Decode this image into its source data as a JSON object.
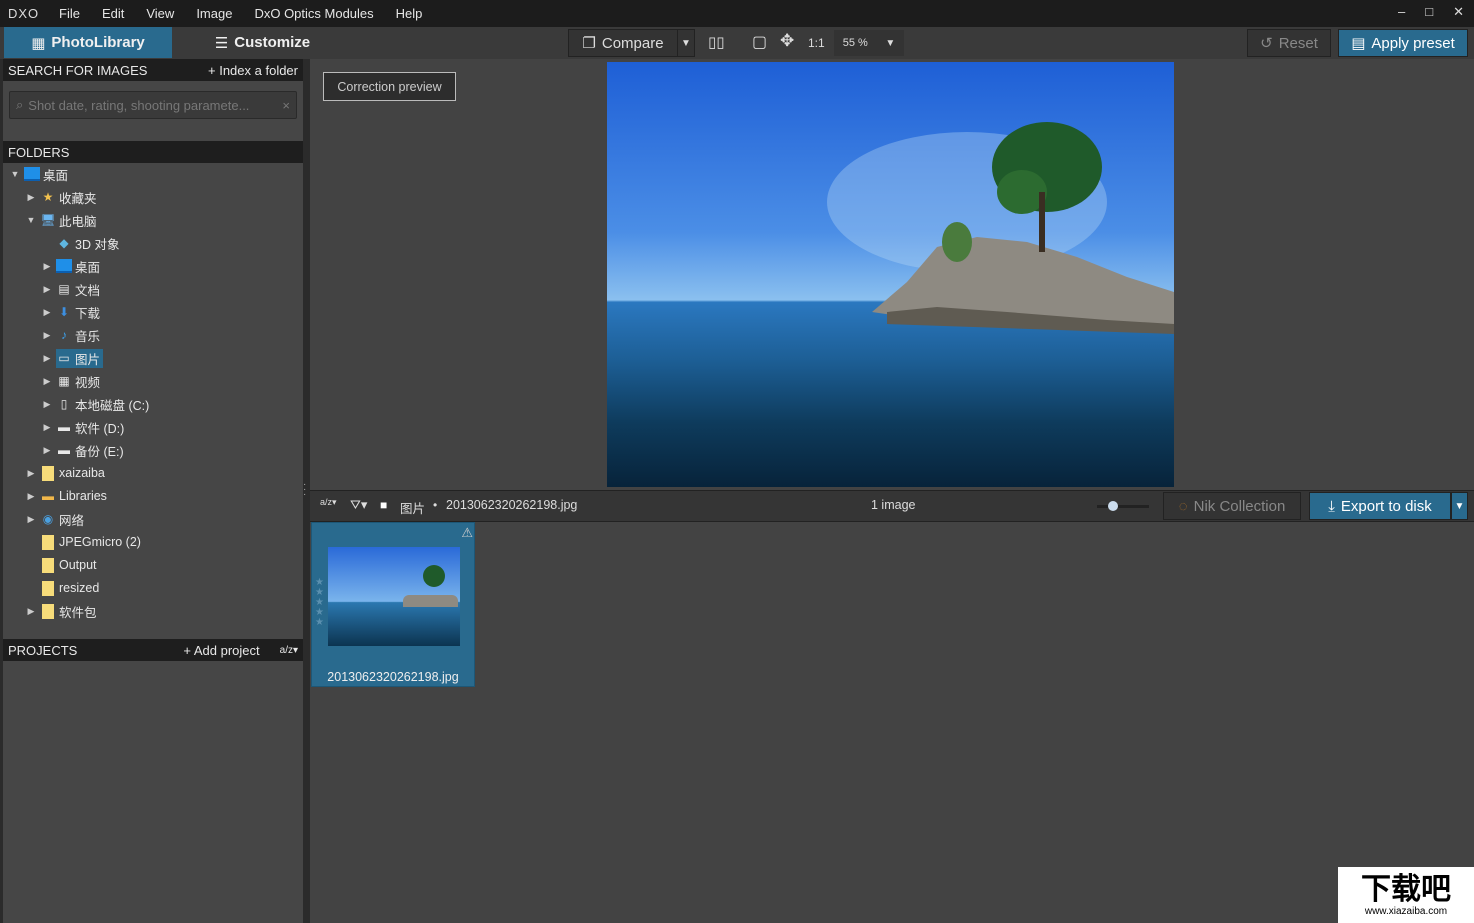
{
  "menubar": {
    "logo": "DXO",
    "items": [
      "File",
      "Edit",
      "View",
      "Image",
      "DxO Optics Modules",
      "Help"
    ]
  },
  "tabs": {
    "photolibrary": "PhotoLibrary",
    "customize": "Customize"
  },
  "toolbar": {
    "compare": "Compare",
    "one_to_one": "1:1",
    "zoom": "55 %",
    "reset": "Reset",
    "apply_preset": "Apply preset"
  },
  "search": {
    "title": "SEARCH FOR IMAGES",
    "index_folder": "+ Index a folder",
    "placeholder": "Shot date, rating, shooting paramete..."
  },
  "folders": {
    "title": "FOLDERS",
    "items": [
      {
        "label": "桌面",
        "level": 0,
        "arrow": "down",
        "icon": "desktop"
      },
      {
        "label": "收藏夹",
        "level": 1,
        "arrow": "right",
        "icon": "star"
      },
      {
        "label": "此电脑",
        "level": 1,
        "arrow": "down",
        "icon": "computer"
      },
      {
        "label": "3D 对象",
        "level": 2,
        "arrow": "",
        "icon": "cube"
      },
      {
        "label": "桌面",
        "level": 2,
        "arrow": "right",
        "icon": "desktop"
      },
      {
        "label": "文档",
        "level": 2,
        "arrow": "right",
        "icon": "document"
      },
      {
        "label": "下载",
        "level": 2,
        "arrow": "right",
        "icon": "download"
      },
      {
        "label": "音乐",
        "level": 2,
        "arrow": "right",
        "icon": "music"
      },
      {
        "label": "图片",
        "level": 2,
        "arrow": "right",
        "icon": "picture",
        "selected": true
      },
      {
        "label": "视频",
        "level": 2,
        "arrow": "right",
        "icon": "video"
      },
      {
        "label": "本地磁盘 (C:)",
        "level": 2,
        "arrow": "right",
        "icon": "disk"
      },
      {
        "label": "软件 (D:)",
        "level": 2,
        "arrow": "right",
        "icon": "drive"
      },
      {
        "label": "备份 (E:)",
        "level": 2,
        "arrow": "right",
        "icon": "drive"
      },
      {
        "label": "xaizaiba",
        "level": 1,
        "arrow": "right",
        "icon": "folder"
      },
      {
        "label": "Libraries",
        "level": 1,
        "arrow": "right",
        "icon": "libraries"
      },
      {
        "label": "网络",
        "level": 1,
        "arrow": "right",
        "icon": "network"
      },
      {
        "label": "JPEGmicro (2)",
        "level": 1,
        "arrow": "",
        "icon": "folder"
      },
      {
        "label": "Output",
        "level": 1,
        "arrow": "",
        "icon": "folder"
      },
      {
        "label": "resized",
        "level": 1,
        "arrow": "",
        "icon": "folder"
      },
      {
        "label": "软件包",
        "level": 1,
        "arrow": "right",
        "icon": "folder"
      }
    ]
  },
  "projects": {
    "title": "PROJECTS",
    "add": "+ Add project"
  },
  "viewer": {
    "correction_preview": "Correction preview"
  },
  "filmstrip": {
    "folder": "图片",
    "file": "2013062320262198.jpg",
    "count": "1 image",
    "nik": "Nik Collection",
    "export": "Export to disk"
  },
  "thumbnail": {
    "filename": "2013062320262198.jpg",
    "rating": 0
  },
  "watermark": {
    "text": "下载吧",
    "url": "www.xiazaiba.com"
  },
  "colors": {
    "accent": "#296a8e",
    "panel": "#464646",
    "header": "#1e1e1e"
  }
}
